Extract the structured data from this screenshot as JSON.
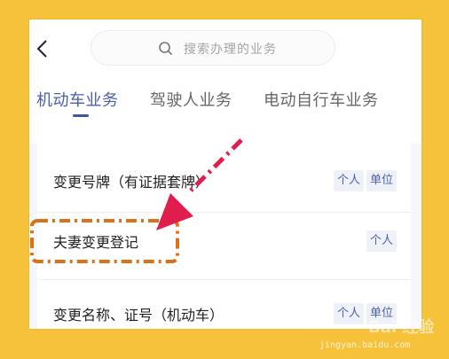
{
  "search": {
    "placeholder": "搜索办理的业务"
  },
  "tabs": [
    {
      "label": "机动车业务",
      "active": true
    },
    {
      "label": "驾驶人业务",
      "active": false
    },
    {
      "label": "电动自行车业务",
      "active": false
    }
  ],
  "services": [
    {
      "label": "变更号牌（有证据套牌）",
      "tags": [
        "个人",
        "单位"
      ]
    },
    {
      "label": "夫妻变更登记",
      "tags": [
        "个人"
      ]
    },
    {
      "label": "变更名称、证号（机动车）",
      "tags": [
        "个人",
        "单位"
      ]
    }
  ],
  "watermark": {
    "logo": "Bai 经验",
    "url": "jingyan.baidu.com"
  },
  "colors": {
    "background": "#f5c23a",
    "accent": "#4a5fa8",
    "annotation": "#e01e4e",
    "highlight_box": "#d9731a"
  }
}
